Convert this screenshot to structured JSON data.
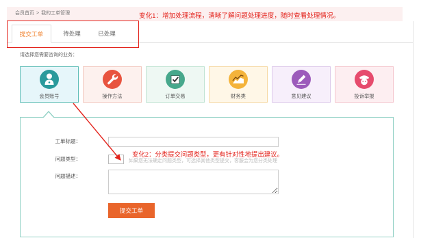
{
  "breadcrumb": {
    "home": "会员首页",
    "separator": ">",
    "current": "我的工单管理"
  },
  "annotations": {
    "change1": "变化1：增加处理流程，清晰了解问题处理进度，随时查看处理情况。",
    "change2": "变化2：分类提交问题类型，更有针对性地提出建议。"
  },
  "tabs": [
    {
      "label": "提交工单",
      "active": true
    },
    {
      "label": "待处理",
      "active": false
    },
    {
      "label": "已处理",
      "active": false
    }
  ],
  "categories": {
    "prompt": "请选择您需要咨询的业务：",
    "items": [
      {
        "label": "会员账号",
        "icon": "user-icon",
        "color": "#2a9a9c",
        "bg": "#e6f6fa",
        "border": "#5dbdb6",
        "selected": true
      },
      {
        "label": "操作方法",
        "icon": "wrench-icon",
        "color": "#e8543f",
        "bg": "#fdf1ee",
        "border": "#f2c8bf",
        "selected": false
      },
      {
        "label": "订单交易",
        "icon": "checkbox-icon",
        "color": "#47a88c",
        "bg": "#eef8f3",
        "border": "#bfe3d2",
        "selected": false
      },
      {
        "label": "财务类",
        "icon": "chart-icon",
        "color": "#f4b33a",
        "bg": "#fff7e7",
        "border": "#f6d8a2",
        "selected": false
      },
      {
        "label": "意见建议",
        "icon": "pencil-icon",
        "color": "#9c5bbb",
        "bg": "#f7effb",
        "border": "#dcc8ea",
        "selected": false
      },
      {
        "label": "投诉举报",
        "icon": "officer-icon",
        "color": "#e64b6d",
        "bg": "#fdeef1",
        "border": "#f4c5cd",
        "selected": false
      }
    ]
  },
  "form": {
    "title_label": "工单标题：",
    "title_value": "",
    "type_label": "问题类型：",
    "type_value": "",
    "type_dropdown_icon": "chevron-down-icon",
    "type_hint": "如果您无法确定问题类型，可选择其他类型提交，客服会为您分类处理",
    "desc_label": "问题描述：",
    "desc_value": "",
    "submit_label": "提交工单"
  },
  "colors": {
    "accent": "#f0812c",
    "button": "#e9652b",
    "annotation": "#e3231c",
    "panel_border": "#8fd0c4"
  }
}
